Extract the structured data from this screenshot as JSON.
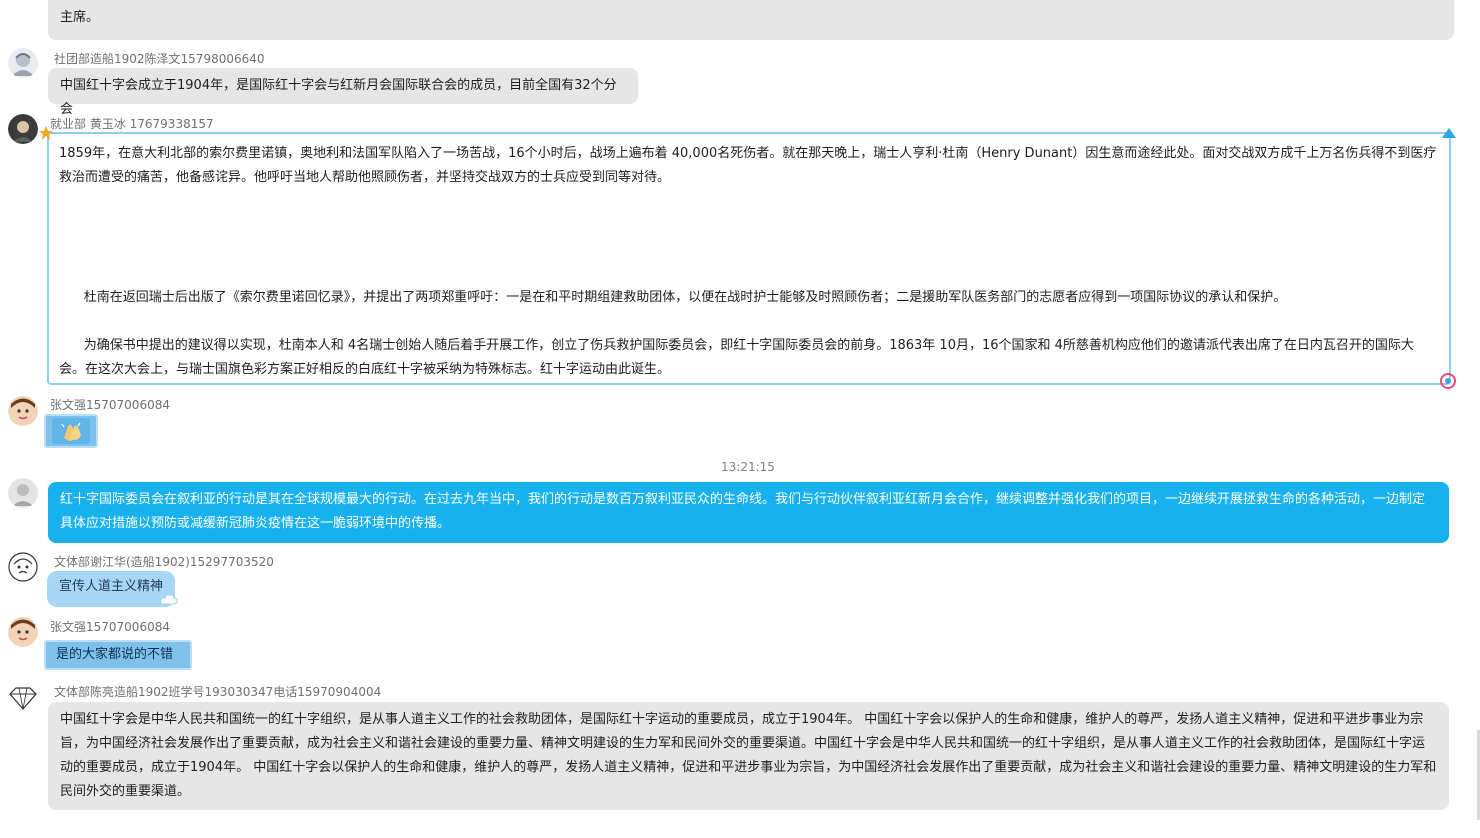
{
  "messages": [
    {
      "text": "中国红十字会与红十字国际委员会、红十字会与红新月会国际联合会和许多国家红十字会有着良好关系与合作，也积极援助航国家红十字会。1999年以来，中国红十字会曾三次担任红十字会与红新月会国际联合会执行委员会成员，并担任副主席。"
    },
    {
      "sender": "社团部造船1902陈泽文15798006640",
      "text": "中国红十字会成立于1904年，是国际红十字会与红新月会国际联合会的成员，目前全国有32个分会"
    },
    {
      "sender": "就业部 黄玉冰 17679338157",
      "paragraphs": [
        "1859年，在意大利北部的索尔费里诺镇，奥地利和法国军队陷入了一场苦战，16个小时后，战场上遍布着 40,000名死伤者。就在那天晚上，瑞士人亨利·杜南（Henry Dunant）因生意而途经此处。面对交战双方成千上万名伤兵得不到医疗救治而遭受的痛苦，他备感诧异。他呼吁当地人帮助他照顾伤者，并坚持交战双方的士兵应受到同等对待。",
        "      杜南在返回瑞士后出版了《索尔费里诺回忆录》，并提出了两项郑重呼吁：一是在和平时期组建救助团体，以便在战时护士能够及时照顾伤者；二是援助军队医务部门的志愿者应得到一项国际协议的承认和保护。",
        "      为确保书中提出的建议得以实现，杜南本人和 4名瑞士创始人随后着手开展工作，创立了伤兵救护国际委员会，即红十字国际委员会的前身。1863年 10月，16个国家和 4所慈善机构应他们的邀请派代表出席了在日内瓦召开的国际大会。在这次大会上，与瑞士国旗色彩方案正好相反的白底红十字被采纳为特殊标志。红十字运动由此诞生。"
      ]
    },
    {
      "sender": "张文强15707006084",
      "emoji_name": "clapping-hands-emoji"
    },
    {
      "timestamp": "13:21:15"
    },
    {
      "text": "红十字国际委员会在叙利亚的行动是其在全球规模最大的行动。在过去九年当中，我们的行动是数百万叙利亚民众的生命线。我们与行动伙伴叙利亚红新月会合作，继续调整并强化我们的项目，一边继续开展拯救生命的各种活动，一边制定具体应对措施以预防或减缓新冠肺炎疫情在这一脆弱环境中的传播。"
    },
    {
      "sender": "文体部谢江华(造船1902)15297703520",
      "text": "宣传人道主义精神"
    },
    {
      "sender": "张文强15707006084",
      "text": "是的大家都说的不错"
    },
    {
      "sender": "文体部陈亮造船1902班学号193030347电话15970904004",
      "text": "中国红十字会是中华人民共和国统一的红十字组织，是从事人道主义工作的社会救助团体，是国际红十字运动的重要成员，成立于1904年。 中国红十字会以保护人的生命和健康，维护人的尊严，发扬人道主义精神，促进和平进步事业为宗旨，为中国经济社会发展作出了重要贡献，成为社会主义和谐社会建设的重要力量、精神文明建设的生力军和民间外交的重要渠道。中国红十字会是中华人民共和国统一的红十字组织，是从事人道主义工作的社会救助团体，是国际红十字运动的重要成员，成立于1904年。 中国红十字会以保护人的生命和健康，维护人的尊严，发扬人道主义精神，促进和平进步事业为宗旨，为中国经济社会发展作出了重要贡献，成为社会主义和谐社会建设的重要力量、精神文明建设的生力军和民间外交的重要渠道。"
    }
  ],
  "colors": {
    "gray_bubble": "#e6e6e6",
    "blue_bubble": "#17b2ee",
    "frame_border": "#8fcdf0",
    "cloud_bubble": "#a8d7f5",
    "tag_bubble": "#7ec2ec"
  }
}
